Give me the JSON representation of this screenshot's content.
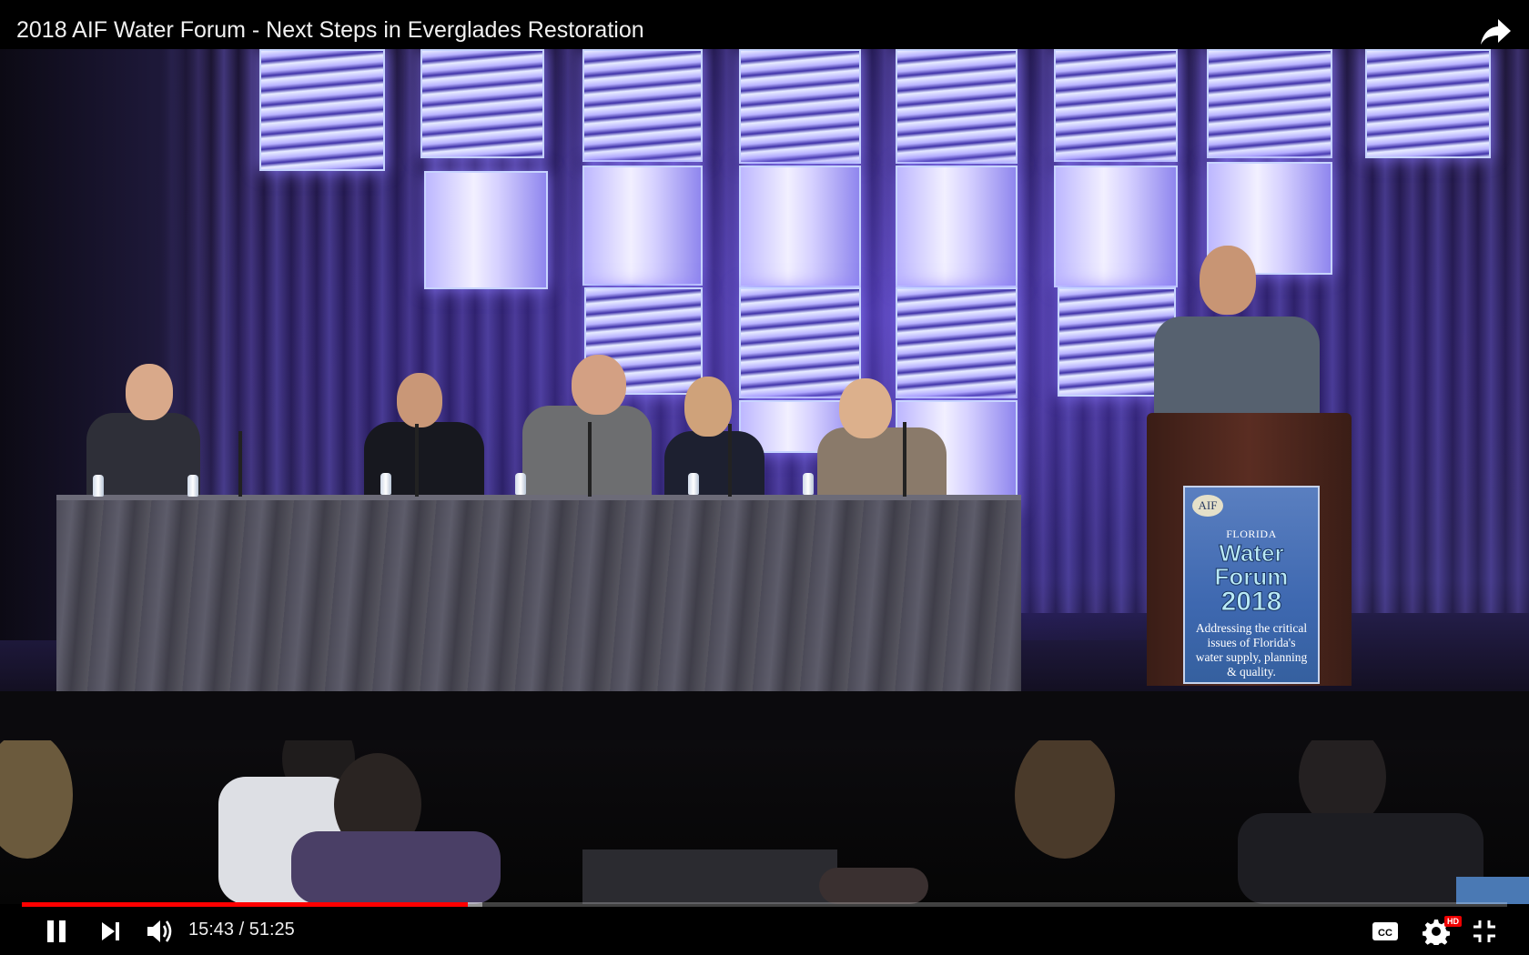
{
  "video": {
    "title": "2018 AIF Water Forum - Next Steps in Everglades Restoration",
    "progress_played_fraction": 0.3,
    "progress_loaded_fraction": 0.31
  },
  "player": {
    "current_time": "15:43",
    "separator": " / ",
    "duration": "51:25",
    "accent_color": "#ff0000"
  },
  "icons": {
    "share": "share-icon",
    "pause": "pause-icon",
    "next": "next-icon",
    "volume": "volume-icon",
    "captions": "cc-icon",
    "settings": "settings-gear-icon",
    "exit_fullscreen": "exit-fullscreen-icon"
  },
  "badges": {
    "cc": "CC",
    "quality": "HD"
  },
  "scene": {
    "podium_sign": {
      "logo": "AIF",
      "brand": "FLORIDA",
      "title": "Water Forum",
      "year": "2018",
      "tagline": "Addressing the critical issues of Florida's water supply, planning & quality."
    }
  }
}
